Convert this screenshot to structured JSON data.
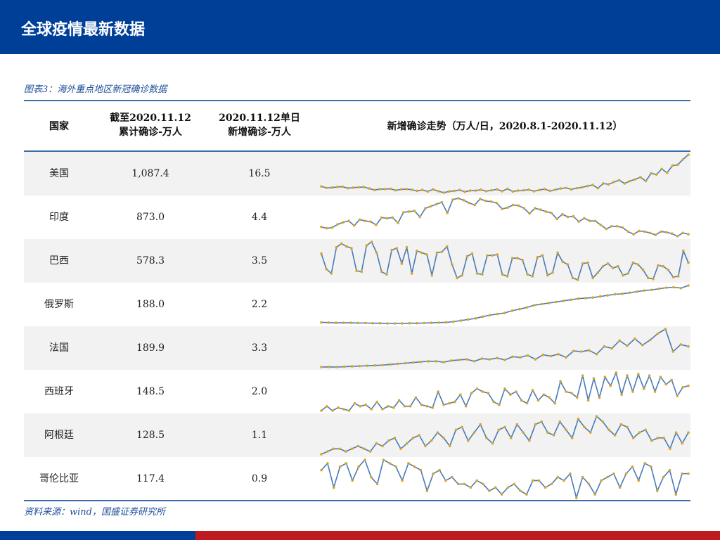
{
  "header": {
    "title": "全球疫情最新数据"
  },
  "caption": "图表3：海外重点地区新冠确诊数据",
  "source": "资料来源：wind，国盛证券研究所",
  "table": {
    "columns": [
      "国家",
      "截至2020.11.12\n累计确诊-万人",
      "2020.11.12单日\n新增确诊-万人",
      "新增确诊走势（万人/日，2020.8.1-2020.11.12）"
    ],
    "col2_l1": "截至2020.11.12",
    "col2_l2": "累计确诊-万人",
    "col3_l1": "2020.11.12单日",
    "col3_l2": "新增确诊-万人",
    "rows": [
      {
        "country": "美国",
        "cumulative": "1,087.4",
        "daily": "16.5",
        "trend": [
          5.8,
          5.3,
          5.4,
          5.6,
          5.7,
          5.2,
          5.4,
          5.5,
          5.6,
          5.1,
          4.6,
          4.9,
          4.9,
          5,
          4.5,
          4.8,
          4.9,
          4.7,
          4.3,
          4.6,
          4.1,
          4.8,
          4.2,
          3.7,
          4.1,
          4.3,
          4.6,
          4,
          4.4,
          4.4,
          4.7,
          4.2,
          4.5,
          4.8,
          4.2,
          5,
          4.1,
          4.4,
          4.5,
          4.7,
          4.2,
          4.6,
          4.9,
          4.3,
          4.7,
          5.1,
          5.3,
          4.8,
          5.2,
          5.5,
          5.9,
          6.3,
          5.2,
          6.8,
          6.5,
          7.3,
          7.9,
          6.8,
          7.6,
          8.2,
          8.9,
          7.6,
          10.2,
          9.8,
          11.7,
          10.4,
          12.8,
          13.1,
          14.9,
          16.5
        ]
      },
      {
        "country": "印度",
        "cumulative": "873.0",
        "daily": "4.4",
        "trend": [
          5.5,
          5.3,
          5.4,
          5.9,
          6.2,
          6.4,
          5.7,
          6.6,
          6.4,
          6.3,
          5.8,
          6.9,
          6.8,
          6.9,
          6.1,
          7.7,
          7.8,
          7.9,
          7,
          8.3,
          8.6,
          8.9,
          9.2,
          7.6,
          9.6,
          9.8,
          9.5,
          9.1,
          8.8,
          9.7,
          9.4,
          9.3,
          9.1,
          8.2,
          8.4,
          8.8,
          8.7,
          8.3,
          7.5,
          8.3,
          8.1,
          7.8,
          7.6,
          6.7,
          7.4,
          7,
          7.1,
          6.3,
          6.8,
          6.4,
          6.4,
          5.8,
          5.2,
          5.6,
          5.6,
          5.4,
          4.8,
          4.4,
          4.9,
          4.8,
          4.6,
          4.3,
          4.8,
          4.7,
          4.5,
          4.1,
          4.6,
          4.4
        ]
      },
      {
        "country": "巴西",
        "cumulative": "578.3",
        "daily": "3.5",
        "trend": [
          4.5,
          2.8,
          2.3,
          5.2,
          5.6,
          5.3,
          5.1,
          2.6,
          2.5,
          5.4,
          5.8,
          4.6,
          2.5,
          2.2,
          4.9,
          5.1,
          3.4,
          5.2,
          2.3,
          4.8,
          4.6,
          4.4,
          2.1,
          4.6,
          4.7,
          5.3,
          3.3,
          1.8,
          2.1,
          4.2,
          4.5,
          2.3,
          2.2,
          4.3,
          4.3,
          4.4,
          2.2,
          2,
          4,
          4,
          3.8,
          2.2,
          2,
          4.1,
          4.3,
          2.1,
          2.4,
          4.6,
          3.6,
          3.3,
          1.8,
          1.6,
          3.4,
          3.5,
          1.8,
          2.4,
          3.1,
          3.4,
          2.9,
          3.1,
          2.1,
          2.3,
          3.5,
          3.3,
          2.7,
          1.8,
          1.7,
          3.2,
          3.1,
          2.7,
          1.9,
          2,
          4.8,
          3.5
        ]
      },
      {
        "country": "俄罗斯",
        "cumulative": "188.0",
        "daily": "2.2",
        "trend": [
          0.52,
          0.51,
          0.5,
          0.5,
          0.5,
          0.49,
          0.49,
          0.48,
          0.48,
          0.47,
          0.47,
          0.47,
          0.48,
          0.48,
          0.49,
          0.5,
          0.51,
          0.52,
          0.55,
          0.6,
          0.65,
          0.7,
          0.78,
          0.85,
          0.9,
          0.95,
          1.05,
          1.12,
          1.2,
          1.3,
          1.35,
          1.4,
          1.45,
          1.5,
          1.55,
          1.6,
          1.62,
          1.65,
          1.7,
          1.75,
          1.8,
          1.82,
          1.87,
          1.92,
          1.97,
          2.0,
          2.05,
          2.1,
          2.12,
          2.08,
          2.2
        ]
      },
      {
        "country": "法国",
        "cumulative": "189.9",
        "daily": "3.3",
        "trend": [
          0.1,
          0.12,
          0.1,
          0.15,
          0.2,
          0.25,
          0.3,
          0.35,
          0.4,
          0.5,
          0.6,
          0.7,
          0.8,
          0.9,
          1,
          1,
          0.85,
          1.1,
          1.2,
          1.3,
          1.0,
          1.4,
          1.3,
          1.5,
          1.2,
          1.7,
          1.6,
          1.9,
          1.3,
          2,
          1.8,
          2.1,
          1.6,
          2.6,
          2.5,
          2.7,
          2.1,
          3.3,
          3,
          4.2,
          3.4,
          4.5,
          3.5,
          4.3,
          5.3,
          6,
          2.5,
          3.6,
          3.3
        ]
      },
      {
        "country": "西班牙",
        "cumulative": "148.5",
        "daily": "2.0",
        "trend": [
          0.3,
          0.6,
          0.3,
          0.5,
          0.4,
          0.3,
          0.8,
          0.6,
          0.7,
          0.4,
          0.9,
          0.4,
          0.6,
          0.5,
          1,
          0.6,
          0.6,
          1.2,
          0.7,
          0.6,
          0.5,
          1.6,
          0.7,
          0.8,
          0.9,
          1.4,
          0.6,
          1.5,
          1.8,
          1.6,
          1.5,
          0.9,
          0.7,
          1.8,
          1.4,
          1.6,
          1,
          0.8,
          1.7,
          1,
          1.4,
          1.2,
          0.8,
          2.3,
          1.6,
          1.5,
          1.2,
          2.7,
          1,
          2.5,
          1.2,
          2.6,
          2,
          2.9,
          1.4,
          2.7,
          1.6,
          2.8,
          1.8,
          2.7,
          1.6,
          2.6,
          2.1,
          2.4,
          1.3,
          1.9,
          2
        ]
      },
      {
        "country": "阿根廷",
        "cumulative": "128.5",
        "daily": "1.1",
        "trend": [
          0.3,
          0.4,
          0.5,
          0.5,
          0.4,
          0.5,
          0.6,
          0.5,
          0.4,
          0.7,
          0.6,
          0.8,
          0.9,
          0.5,
          0.7,
          0.9,
          1,
          0.6,
          0.8,
          1.1,
          0.9,
          0.6,
          1.2,
          1.3,
          0.8,
          1.1,
          1.4,
          0.9,
          0.7,
          1.2,
          1.3,
          0.9,
          1.4,
          1.1,
          0.8,
          1.4,
          1.5,
          1.1,
          1,
          1.5,
          1.2,
          0.9,
          1.6,
          1.3,
          1.1,
          1.7,
          1.5,
          1.2,
          1,
          1.4,
          1.3,
          0.9,
          1.1,
          1.2,
          0.8,
          0.9,
          0.9,
          0.5,
          1.1,
          0.7,
          1.1
        ]
      },
      {
        "country": "哥伦比亚",
        "cumulative": "117.4",
        "daily": "0.9",
        "trend": [
          1.0,
          1.2,
          0.5,
          1.1,
          1.2,
          0.7,
          1.1,
          1.3,
          0.8,
          0.6,
          1.3,
          1.2,
          1.1,
          0.7,
          1.2,
          1.1,
          1.0,
          0.4,
          0.9,
          1,
          0.7,
          0.8,
          0.6,
          0.6,
          0.5,
          0.7,
          0.6,
          0.4,
          0.5,
          0.3,
          0.5,
          0.6,
          0.4,
          0.3,
          0.7,
          0.7,
          0.5,
          0.6,
          0.8,
          0.7,
          0.9,
          0.2,
          0.8,
          0.6,
          0.3,
          0.7,
          0.8,
          0.9,
          0.5,
          0.9,
          1.1,
          0.7,
          1.2,
          1.1,
          0.4,
          0.8,
          1.0,
          0.3,
          0.9,
          0.9
        ]
      }
    ]
  },
  "colors": {
    "brand_blue": "#003f98",
    "brand_red": "#be1a1f",
    "line": "#4a7ab5",
    "marker": "#d9a521"
  }
}
